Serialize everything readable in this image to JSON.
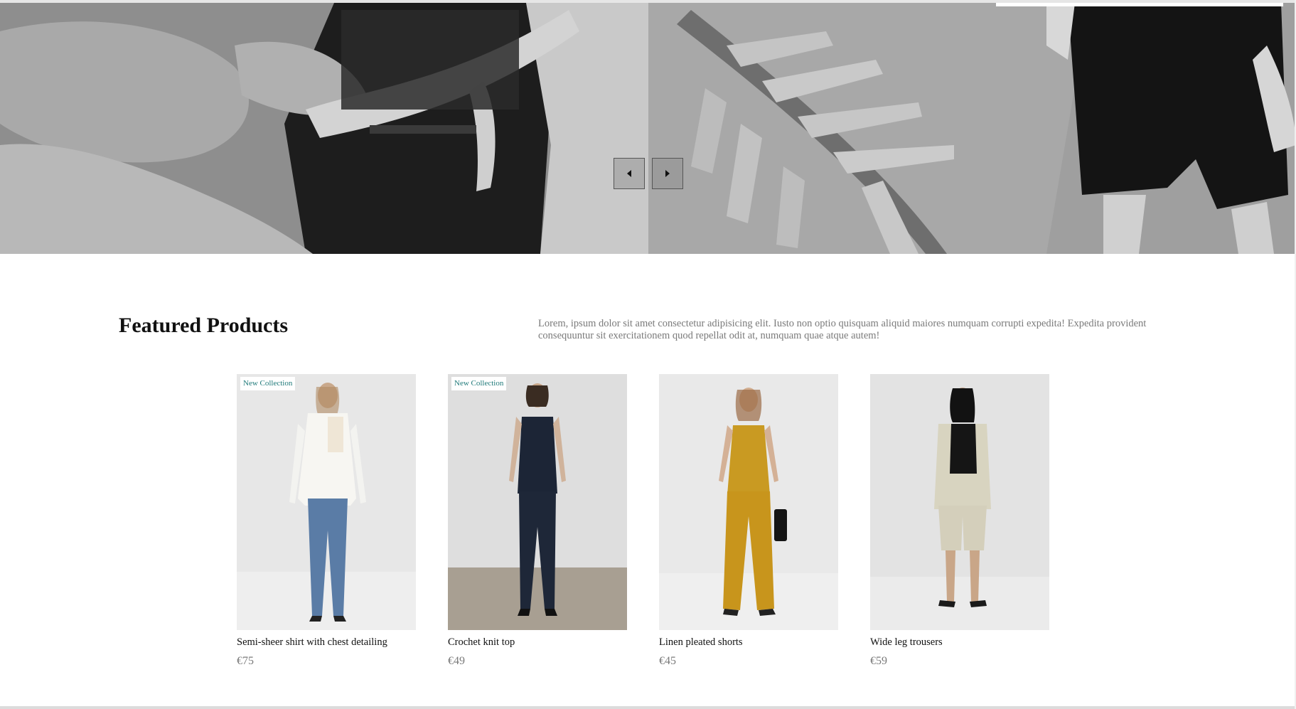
{
  "hero": {
    "prev_label": "Previous slide",
    "next_label": "Next slide"
  },
  "featured": {
    "title": "Featured Products",
    "description": "Lorem, ipsum dolor sit amet consectetur adipisicing elit. Iusto non optio quisquam aliquid maiores numquam corrupti expedita! Expedita provident consequuntur sit exercitationem quod repellat odit at, numquam quae atque autem!"
  },
  "products": [
    {
      "name": "Semi-sheer shirt with chest detailing",
      "price": "€75",
      "badge": "New Collection"
    },
    {
      "name": "Crochet knit top",
      "price": "€49",
      "badge": "New Collection"
    },
    {
      "name": "Linen pleated shorts",
      "price": "€45",
      "badge": ""
    },
    {
      "name": "Wide leg trousers",
      "price": "€59",
      "badge": ""
    }
  ],
  "colors": {
    "badge_text": "#1f7a7a",
    "price_text": "#7a7a7a",
    "description_text": "#7a7a7a"
  }
}
